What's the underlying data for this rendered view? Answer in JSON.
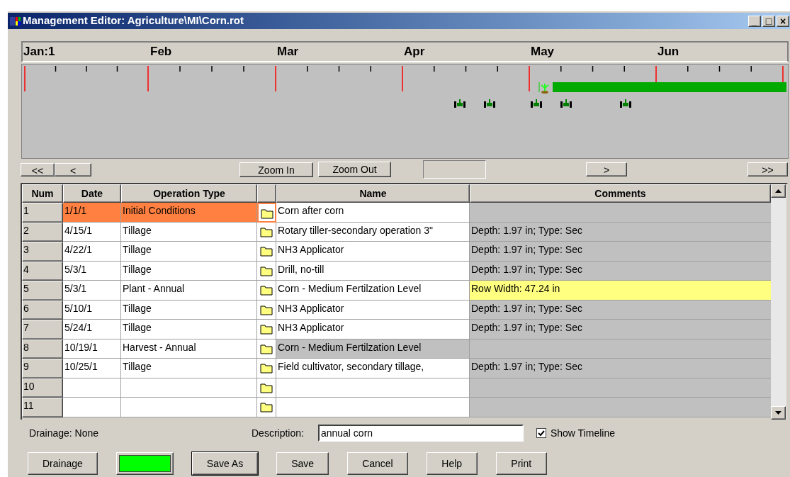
{
  "window": {
    "title": "Management Editor: Agriculture\\MI\\Corn.rot",
    "controls": [
      "_",
      "□",
      "×"
    ]
  },
  "timeline": {
    "months": [
      "Jan:1",
      "Feb",
      "Mar",
      "Apr",
      "May",
      "Jun"
    ]
  },
  "nav": {
    "first": "<<",
    "prev": "<",
    "zoom_in": "Zoom In",
    "zoom_out": "Zoom Out",
    "next": ">",
    "last": ">>"
  },
  "table": {
    "columns": [
      "Num",
      "Date",
      "Operation Type",
      "Name",
      "Comments"
    ],
    "rows": [
      {
        "num": "1",
        "date": "1/1/1",
        "operation": "Initial Conditions",
        "name": "Corn after corn",
        "comment": "",
        "selected": true,
        "comment_highlighted": false,
        "name_greyed": false
      },
      {
        "num": "2",
        "date": "4/15/1",
        "operation": "Tillage",
        "name": "Rotary tiller-secondary operation 3\"",
        "comment": "Depth: 1.97 in; Type: Sec",
        "selected": false,
        "comment_highlighted": false,
        "name_greyed": false
      },
      {
        "num": "3",
        "date": "4/22/1",
        "operation": "Tillage",
        "name": "NH3 Applicator",
        "comment": "Depth: 1.97 in; Type: Sec",
        "selected": false,
        "comment_highlighted": false,
        "name_greyed": false
      },
      {
        "num": "4",
        "date": "5/3/1",
        "operation": "Tillage",
        "name": "Drill, no-till",
        "comment": "Depth: 1.97 in; Type: Sec",
        "selected": false,
        "comment_highlighted": false,
        "name_greyed": false
      },
      {
        "num": "5",
        "date": "5/3/1",
        "operation": "Plant - Annual",
        "name": "Corn - Medium Fertilzation Level",
        "comment": "Row Width: 47.24 in",
        "selected": false,
        "comment_highlighted": true,
        "name_greyed": false
      },
      {
        "num": "6",
        "date": "5/10/1",
        "operation": "Tillage",
        "name": "NH3 Applicator",
        "comment": "Depth: 1.97 in; Type: Sec",
        "selected": false,
        "comment_highlighted": false,
        "name_greyed": false
      },
      {
        "num": "7",
        "date": "5/24/1",
        "operation": "Tillage",
        "name": "NH3 Applicator",
        "comment": "Depth: 1.97 in; Type: Sec",
        "selected": false,
        "comment_highlighted": false,
        "name_greyed": false
      },
      {
        "num": "8",
        "date": "10/19/1",
        "operation": "Harvest - Annual",
        "name": "Corn - Medium Fertilzation Level",
        "comment": "",
        "selected": false,
        "comment_highlighted": false,
        "name_greyed": true
      },
      {
        "num": "9",
        "date": "10/25/1",
        "operation": "Tillage",
        "name": "Field cultivator, secondary tillage,",
        "comment": "Depth: 1.97 in; Type: Sec",
        "selected": false,
        "comment_highlighted": false,
        "name_greyed": false
      },
      {
        "num": "10",
        "date": "",
        "operation": "",
        "name": "",
        "comment": "",
        "selected": false,
        "comment_highlighted": false,
        "name_greyed": false
      },
      {
        "num": "11",
        "date": "",
        "operation": "",
        "name": "",
        "comment": "",
        "selected": false,
        "comment_highlighted": false,
        "name_greyed": false
      }
    ]
  },
  "footer": {
    "drainage": "Drainage: None",
    "description_label": "Description:",
    "description": "annual corn",
    "show_timeline": {
      "label": "Show Timeline",
      "checked": true
    }
  },
  "buttons": [
    {
      "kind": "text",
      "label": "Drainage",
      "default": false
    },
    {
      "kind": "swatch",
      "color": "#00ff00",
      "default": false
    },
    {
      "kind": "text",
      "label": "Save As",
      "default": true
    },
    {
      "kind": "text",
      "label": "Save",
      "default": false
    },
    {
      "kind": "text",
      "label": "Cancel",
      "default": false
    },
    {
      "kind": "text",
      "label": "Help",
      "default": false
    },
    {
      "kind": "text",
      "label": "Print",
      "default": false
    }
  ]
}
